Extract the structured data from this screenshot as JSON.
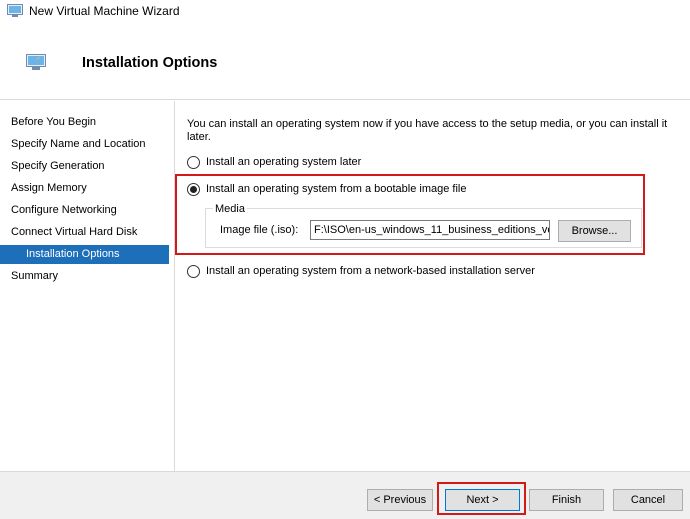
{
  "window": {
    "title": "New Virtual Machine Wizard"
  },
  "header": {
    "title": "Installation Options"
  },
  "nav": {
    "items": [
      {
        "label": "Before You Begin",
        "active": false
      },
      {
        "label": "Specify Name and Location",
        "active": false
      },
      {
        "label": "Specify Generation",
        "active": false
      },
      {
        "label": "Assign Memory",
        "active": false
      },
      {
        "label": "Configure Networking",
        "active": false
      },
      {
        "label": "Connect Virtual Hard Disk",
        "active": false
      },
      {
        "label": "Installation Options",
        "active": true
      },
      {
        "label": "Summary",
        "active": false
      }
    ]
  },
  "content": {
    "intro": "You can install an operating system now if you have access to the setup media, or you can install it later.",
    "options": [
      {
        "label": "Install an operating system later",
        "checked": false
      },
      {
        "label": "Install an operating system from a bootable image file",
        "checked": true
      },
      {
        "label": "Install an operating system from a network-based installation server",
        "checked": false
      }
    ],
    "media": {
      "legend": "Media",
      "iso_label": "Image file (.iso):",
      "iso_value": "F:\\ISO\\en-us_windows_11_business_editions_ve",
      "browse_label": "Browse..."
    }
  },
  "footer": {
    "previous_label": "< Previous",
    "next_label": "Next >",
    "finish_label": "Finish",
    "cancel_label": "Cancel"
  },
  "colors": {
    "accent": "#1e6fba",
    "highlight": "#d11a1a"
  }
}
